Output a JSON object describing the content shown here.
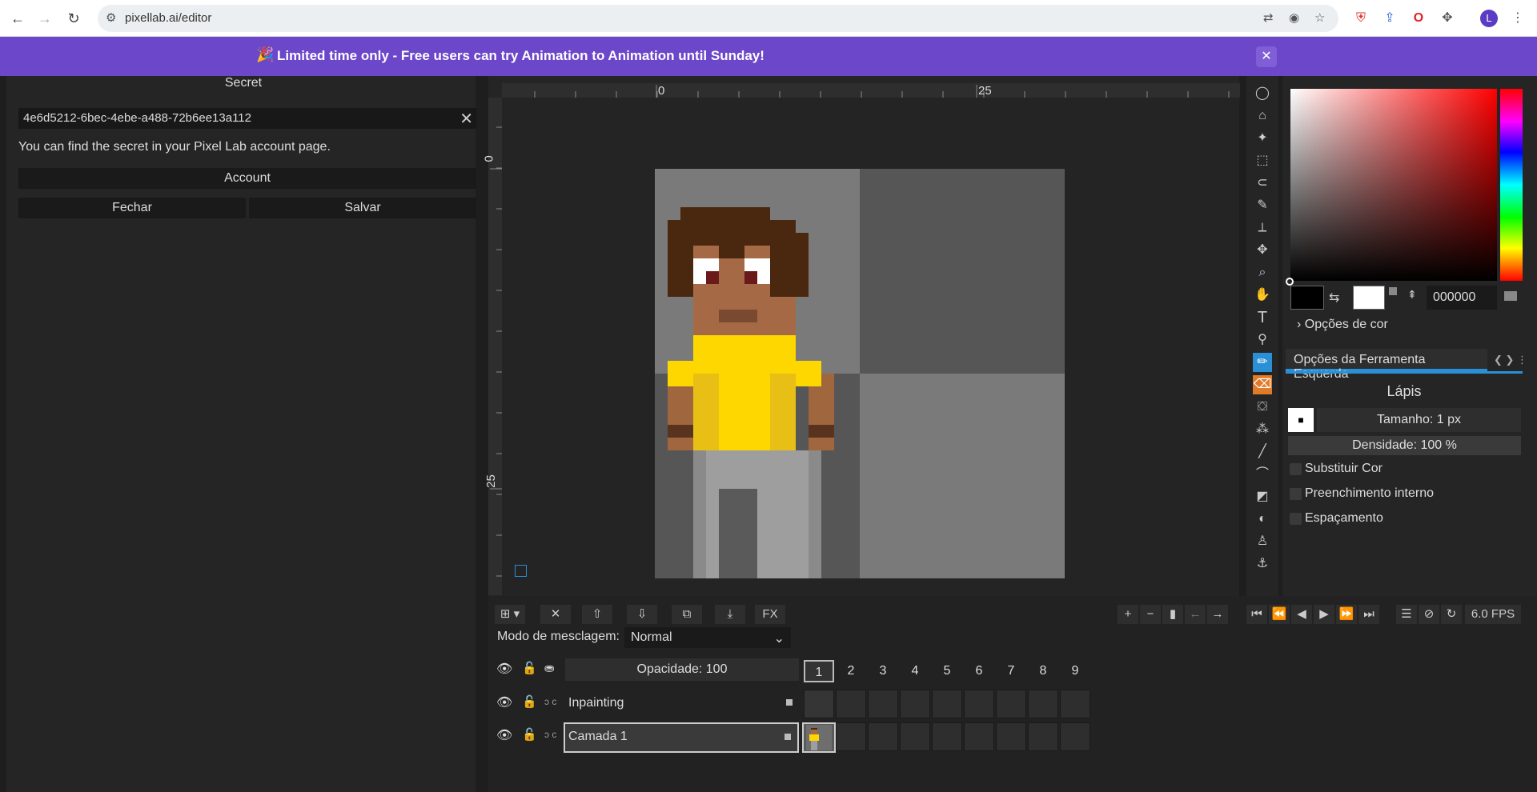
{
  "browser": {
    "url": "pixellab.ai/editor",
    "profile_initial": "L"
  },
  "banner": {
    "icon": "🎉",
    "message": "Limited time only - Free users can try Animation to Animation until Sunday!"
  },
  "secret_dialog": {
    "title": "Secret",
    "secret_value": "4e6d5212-6bec-4ebe-a488-72b6ee13a112",
    "hint": "You can find the secret in your Pixel Lab account page.",
    "account_label": "Account",
    "close_label": "Fechar",
    "save_label": "Salvar"
  },
  "rulers": {
    "top": [
      "0",
      "25"
    ],
    "left": [
      "0",
      "25"
    ]
  },
  "color_panel": {
    "hex_value": "000000",
    "color_options_label": "Opções de cor",
    "primary_color": "#000000",
    "secondary_color": "#ffffff"
  },
  "tool_options": {
    "tab_label": "Opções da Ferramenta Esquerda",
    "tool_name": "Lápis",
    "size_label": "Tamanho: 1 px",
    "density_label": "Densidade: 100 %",
    "option1": "Substituir Cor",
    "option2": "Preenchimento interno",
    "option3": "Espaçamento"
  },
  "timeline": {
    "fps": "6.0 FPS",
    "blend_mode_label": "Modo de mesclagem:",
    "blend_mode_value": "Normal",
    "opacity_label": "Opacidade: 100",
    "frames": [
      "1",
      "2",
      "3",
      "4",
      "5",
      "6",
      "7",
      "8",
      "9"
    ],
    "layers": [
      {
        "name": "Inpainting"
      },
      {
        "name": "Camada 1"
      }
    ],
    "fx_label": "FX"
  },
  "colors": {
    "banner": "#6c47c9",
    "accent": "#2b8fd6",
    "eraser": "#e07b2a"
  }
}
